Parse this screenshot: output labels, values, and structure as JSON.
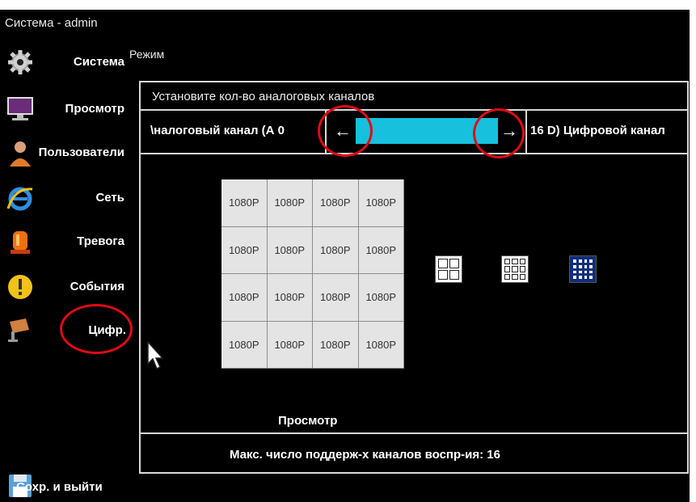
{
  "window": {
    "title": "Система - admin"
  },
  "header": {
    "mode_label": "Режим"
  },
  "sidebar": {
    "items": [
      {
        "label": "Система",
        "icon": "gear-icon"
      },
      {
        "label": "Просмотр",
        "icon": "monitor-icon"
      },
      {
        "label": "Пользователи",
        "icon": "user-icon"
      },
      {
        "label": "Сеть",
        "icon": "internet-explorer-icon"
      },
      {
        "label": "Тревога",
        "icon": "alarm-light-icon"
      },
      {
        "label": "События",
        "icon": "exclamation-icon"
      },
      {
        "label": "Цифр.",
        "icon": "camera-icon"
      }
    ],
    "save_exit": {
      "label": "Сохр. и выйти",
      "icon": "floppy-disk-icon"
    }
  },
  "panel": {
    "heading": "Установите кол-во аналоговых каналов",
    "channel_left_text": "\\налоговый канал (А 0",
    "channel_right_text": "16 D)  Цифровой канал",
    "slider": {
      "left_arrow": "←",
      "right_arrow": "→"
    },
    "preview": {
      "cells": [
        "1080P",
        "1080P",
        "1080P",
        "1080P",
        "1080P",
        "1080P",
        "1080P",
        "1080P",
        "1080P",
        "1080P",
        "1080P",
        "1080P",
        "1080P",
        "1080P",
        "1080P",
        "1080P"
      ],
      "caption": "Просмотр"
    },
    "layout_options": [
      {
        "name": "2x2",
        "selected": false
      },
      {
        "name": "3x3",
        "selected": false
      },
      {
        "name": "4x4",
        "selected": true
      }
    ],
    "max_channels_text": "Макс. число поддерж-х каналов воспр-ия: 16"
  },
  "colors": {
    "accent_cyan": "#17c0dd",
    "annotation_red": "#e00a14",
    "selected_layout": "#0f2e7a"
  }
}
